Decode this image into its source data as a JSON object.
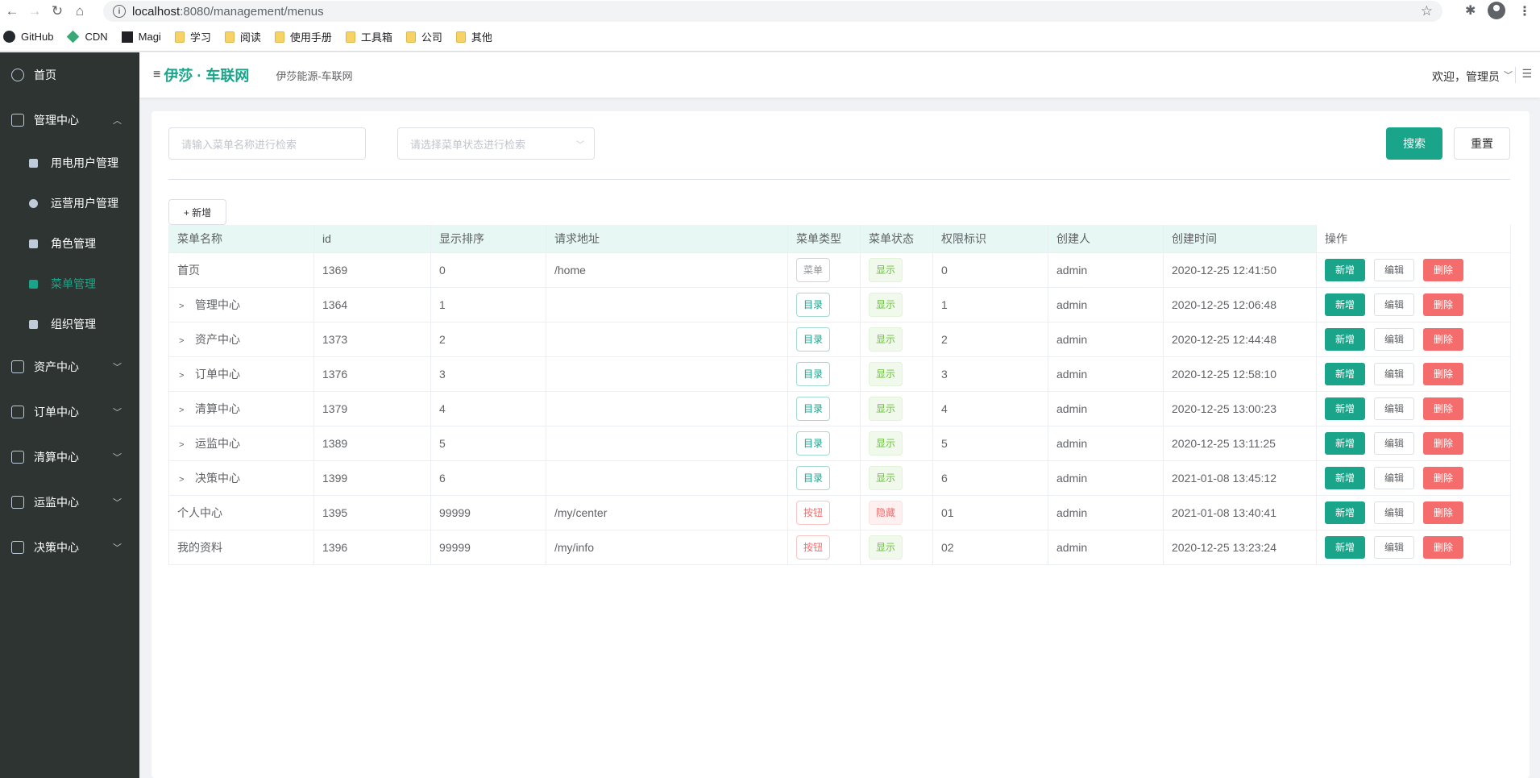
{
  "browser": {
    "url_host": "localhost",
    "url_path": ":8080/management/menus",
    "bookmarks": [
      "GitHub",
      "CDN",
      "Magi",
      "学习",
      "阅读",
      "使用手册",
      "工具箱",
      "公司",
      "其他"
    ]
  },
  "sidebar": {
    "items": [
      {
        "label": "首页",
        "icon": "clock-icon"
      },
      {
        "label": "管理中心",
        "icon": "panel-icon",
        "expanded": true
      },
      {
        "label": "资产中心",
        "icon": "wallet-icon"
      },
      {
        "label": "订单中心",
        "icon": "document-icon"
      },
      {
        "label": "清算中心",
        "icon": "chart-icon"
      },
      {
        "label": "运监中心",
        "icon": "monitor-icon"
      },
      {
        "label": "决策中心",
        "icon": "hammer-icon"
      }
    ],
    "sub_items": [
      {
        "label": "用电用户管理",
        "icon": "user-icon"
      },
      {
        "label": "运营用户管理",
        "icon": "pie-icon"
      },
      {
        "label": "角色管理",
        "icon": "lock-icon"
      },
      {
        "label": "菜单管理",
        "icon": "sliders-icon",
        "active": true
      },
      {
        "label": "组织管理",
        "icon": "org-icon"
      }
    ]
  },
  "header": {
    "brand": "伊莎 · 车联网",
    "subtitle": "伊莎能源-车联网",
    "welcome": "欢迎，管理员"
  },
  "filters": {
    "name_placeholder": "请输入菜单名称进行检索",
    "status_placeholder": "请选择菜单状态进行检索",
    "search_label": "搜索",
    "reset_label": "重置",
    "add_label": "+ 新增"
  },
  "table": {
    "columns": [
      "菜单名称",
      "id",
      "显示排序",
      "请求地址",
      "菜单类型",
      "菜单状态",
      "权限标识",
      "创建人",
      "创建时间",
      "操作"
    ],
    "rows": [
      {
        "name": "首页",
        "expandable": false,
        "id": "1369",
        "order": "0",
        "path": "/home",
        "type": "菜单",
        "type_kind": "menu",
        "status": "显示",
        "status_kind": "show",
        "perm": "0",
        "creator": "admin",
        "created": "2020-12-25 12:41:50"
      },
      {
        "name": "管理中心",
        "expandable": true,
        "id": "1364",
        "order": "1",
        "path": "",
        "type": "目录",
        "type_kind": "dir",
        "status": "显示",
        "status_kind": "show",
        "perm": "1",
        "creator": "admin",
        "created": "2020-12-25 12:06:48"
      },
      {
        "name": "资产中心",
        "expandable": true,
        "id": "1373",
        "order": "2",
        "path": "",
        "type": "目录",
        "type_kind": "dir",
        "status": "显示",
        "status_kind": "show",
        "perm": "2",
        "creator": "admin",
        "created": "2020-12-25 12:44:48"
      },
      {
        "name": "订单中心",
        "expandable": true,
        "id": "1376",
        "order": "3",
        "path": "",
        "type": "目录",
        "type_kind": "dir",
        "status": "显示",
        "status_kind": "show",
        "perm": "3",
        "creator": "admin",
        "created": "2020-12-25 12:58:10"
      },
      {
        "name": "清算中心",
        "expandable": true,
        "id": "1379",
        "order": "4",
        "path": "",
        "type": "目录",
        "type_kind": "dir",
        "status": "显示",
        "status_kind": "show",
        "perm": "4",
        "creator": "admin",
        "created": "2020-12-25 13:00:23"
      },
      {
        "name": "运监中心",
        "expandable": true,
        "id": "1389",
        "order": "5",
        "path": "",
        "type": "目录",
        "type_kind": "dir",
        "status": "显示",
        "status_kind": "show",
        "perm": "5",
        "creator": "admin",
        "created": "2020-12-25 13:11:25"
      },
      {
        "name": "决策中心",
        "expandable": true,
        "id": "1399",
        "order": "6",
        "path": "",
        "type": "目录",
        "type_kind": "dir",
        "status": "显示",
        "status_kind": "show",
        "perm": "6",
        "creator": "admin",
        "created": "2021-01-08 13:45:12"
      },
      {
        "name": "个人中心",
        "expandable": false,
        "id": "1395",
        "order": "99999",
        "path": "/my/center",
        "type": "按钮",
        "type_kind": "btn",
        "status": "隐藏",
        "status_kind": "hide",
        "perm": "01",
        "creator": "admin",
        "created": "2021-01-08 13:40:41"
      },
      {
        "name": "我的资料",
        "expandable": false,
        "id": "1396",
        "order": "99999",
        "path": "/my/info",
        "type": "按钮",
        "type_kind": "btn",
        "status": "显示",
        "status_kind": "show",
        "perm": "02",
        "creator": "admin",
        "created": "2020-12-25 13:23:24"
      }
    ],
    "actions": {
      "add": "新增",
      "edit": "编辑",
      "delete": "删除"
    }
  },
  "colors": {
    "accent": "#1aa58a",
    "danger": "#f56c6c",
    "sidebar_bg": "#2d3431"
  }
}
